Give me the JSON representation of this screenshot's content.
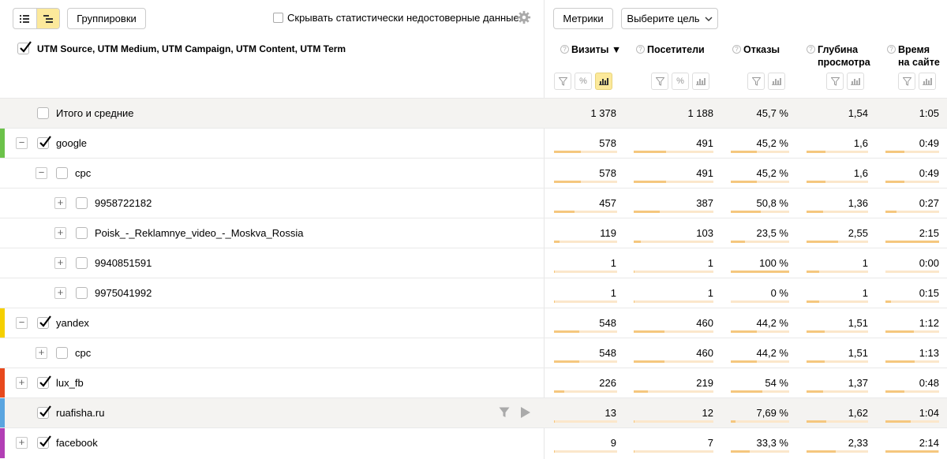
{
  "toolbar": {
    "view_list_icon": "list-icon",
    "view_tree_icon": "tree-icon",
    "groupings_label": "Группировки",
    "hide_unreliable_label": "Скрывать статистически недостоверные данные",
    "metrics_label": "Метрики",
    "goal_select_label": "Выберите цель"
  },
  "header": {
    "dimension_label": "UTM Source, UTM Medium, UTM Campaign, UTM Content, UTM Term",
    "columns": [
      {
        "line1": "Визиты ▼",
        "line2": ""
      },
      {
        "line1": "Посетители",
        "line2": ""
      },
      {
        "line1": "Отказы",
        "line2": ""
      },
      {
        "line1": "Глубина",
        "line2": "просмотра"
      },
      {
        "line1": "Время",
        "line2": "на сайте"
      }
    ],
    "help_glyph": "?",
    "percent_glyph": "%"
  },
  "colors": {
    "accent": "#fce99b",
    "bar": "#f5c77e",
    "bar_bg": "#fbe7cb",
    "google": "#6cc24a",
    "yandex": "#f5d000",
    "lux_fb": "#e8491d",
    "ruafisha": "#5aa5e0",
    "facebook": "#b23fb5"
  },
  "rows": [
    {
      "label": "Итого и средние",
      "level": 0,
      "toggle": "",
      "checked": false,
      "color": "",
      "values": [
        "1 378",
        "1 188",
        "45,7 %",
        "1,54",
        "1:05"
      ],
      "bars": [
        0,
        0,
        0,
        0,
        0
      ],
      "grey": true
    },
    {
      "label": "google",
      "level": 0,
      "toggle": "−",
      "checked": true,
      "color": "#6cc24a",
      "values": [
        "578",
        "491",
        "45,2 %",
        "1,6",
        "0:49"
      ],
      "bars": [
        0.42,
        0.41,
        0.45,
        0.31,
        0.36
      ],
      "grey": false
    },
    {
      "label": "cpc",
      "level": 1,
      "toggle": "−",
      "checked": false,
      "color": "",
      "values": [
        "578",
        "491",
        "45,2 %",
        "1,6",
        "0:49"
      ],
      "bars": [
        0.42,
        0.41,
        0.45,
        0.31,
        0.36
      ],
      "grey": false
    },
    {
      "label": "9958722182",
      "level": 2,
      "toggle": "+",
      "checked": false,
      "color": "",
      "values": [
        "457",
        "387",
        "50,8 %",
        "1,36",
        "0:27"
      ],
      "bars": [
        0.33,
        0.33,
        0.51,
        0.27,
        0.2
      ],
      "grey": false
    },
    {
      "label": "Poisk_-_Reklamnye_video_-_Moskva_Rossia",
      "level": 2,
      "toggle": "+",
      "checked": false,
      "color": "",
      "values": [
        "119",
        "103",
        "23,5 %",
        "2,55",
        "2:15"
      ],
      "bars": [
        0.09,
        0.09,
        0.24,
        0.51,
        1.0
      ],
      "grey": false
    },
    {
      "label": "9940851591",
      "level": 2,
      "toggle": "+",
      "checked": false,
      "color": "",
      "values": [
        "1",
        "1",
        "100 %",
        "1",
        "0:00"
      ],
      "bars": [
        0.01,
        0.01,
        1.0,
        0.2,
        0.0
      ],
      "grey": false
    },
    {
      "label": "9975041992",
      "level": 2,
      "toggle": "+",
      "checked": false,
      "color": "",
      "values": [
        "1",
        "1",
        "0 %",
        "1",
        "0:15"
      ],
      "bars": [
        0.01,
        0.01,
        0.0,
        0.2,
        0.11
      ],
      "grey": false
    },
    {
      "label": "yandex",
      "level": 0,
      "toggle": "−",
      "checked": true,
      "color": "#f5d000",
      "values": [
        "548",
        "460",
        "44,2 %",
        "1,51",
        "1:12"
      ],
      "bars": [
        0.4,
        0.39,
        0.44,
        0.3,
        0.53
      ],
      "grey": false
    },
    {
      "label": "cpc",
      "level": 1,
      "toggle": "+",
      "checked": false,
      "color": "",
      "values": [
        "548",
        "460",
        "44,2 %",
        "1,51",
        "1:13"
      ],
      "bars": [
        0.4,
        0.39,
        0.44,
        0.3,
        0.54
      ],
      "grey": false
    },
    {
      "label": "lux_fb",
      "level": 0,
      "toggle": "+",
      "checked": true,
      "color": "#e8491d",
      "values": [
        "226",
        "219",
        "54 %",
        "1,37",
        "0:48"
      ],
      "bars": [
        0.16,
        0.18,
        0.54,
        0.27,
        0.36
      ],
      "grey": false
    },
    {
      "label": "ruafisha.ru",
      "level": 0,
      "toggle": "",
      "checked": true,
      "color": "#5aa5e0",
      "values": [
        "13",
        "12",
        "7,69 %",
        "1,62",
        "1:04"
      ],
      "bars": [
        0.01,
        0.01,
        0.08,
        0.32,
        0.47
      ],
      "grey": true,
      "actions": true
    },
    {
      "label": "facebook",
      "level": 0,
      "toggle": "+",
      "checked": true,
      "color": "#b23fb5",
      "values": [
        "9",
        "7",
        "33,3 %",
        "2,33",
        "2:14"
      ],
      "bars": [
        0.01,
        0.01,
        0.33,
        0.47,
        0.99
      ],
      "grey": false
    }
  ]
}
